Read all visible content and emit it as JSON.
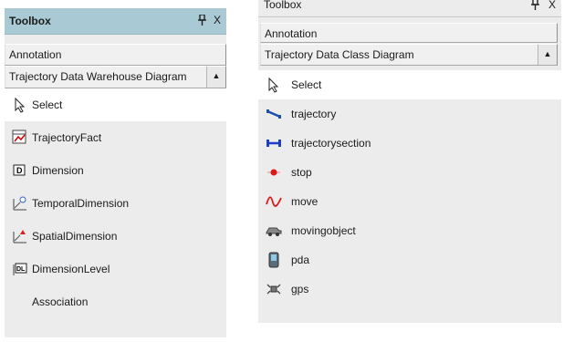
{
  "left_toolbox": {
    "title": "Toolbox",
    "pin_glyph": "❐",
    "close_glyph": "X",
    "category_annotation": "Annotation",
    "category_diagram": "Trajectory Data Warehouse Diagram",
    "scroll_glyph": "▲",
    "items": [
      {
        "label": "Select",
        "icon": "pointer-icon"
      },
      {
        "label": "TrajectoryFact",
        "icon": "fact-icon"
      },
      {
        "label": "Dimension",
        "icon": "dimension-icon"
      },
      {
        "label": "TemporalDimension",
        "icon": "temporal-dimension-icon"
      },
      {
        "label": "SpatialDimension",
        "icon": "spatial-dimension-icon"
      },
      {
        "label": "DimensionLevel",
        "icon": "dimension-level-icon"
      },
      {
        "label": "Association",
        "icon": ""
      }
    ]
  },
  "right_toolbox": {
    "title": "Toolbox",
    "pin_glyph": "❐",
    "close_glyph": "X",
    "category_annotation": "Annotation",
    "category_diagram": "Trajectory Data Class Diagram",
    "scroll_glyph": "▲",
    "items": [
      {
        "label": "Select",
        "icon": "pointer-icon"
      },
      {
        "label": "trajectory",
        "icon": "trajectory-icon"
      },
      {
        "label": "trajectorysection",
        "icon": "trajectory-section-icon"
      },
      {
        "label": "stop",
        "icon": "stop-icon"
      },
      {
        "label": "move",
        "icon": "move-icon"
      },
      {
        "label": "movingobject",
        "icon": "moving-object-icon"
      },
      {
        "label": "pda",
        "icon": "pda-icon"
      },
      {
        "label": "gps",
        "icon": "gps-icon"
      }
    ]
  },
  "colors": {
    "title_bar": "#a9c9d4",
    "panel": "#ececec",
    "selected": "#ffffff"
  }
}
